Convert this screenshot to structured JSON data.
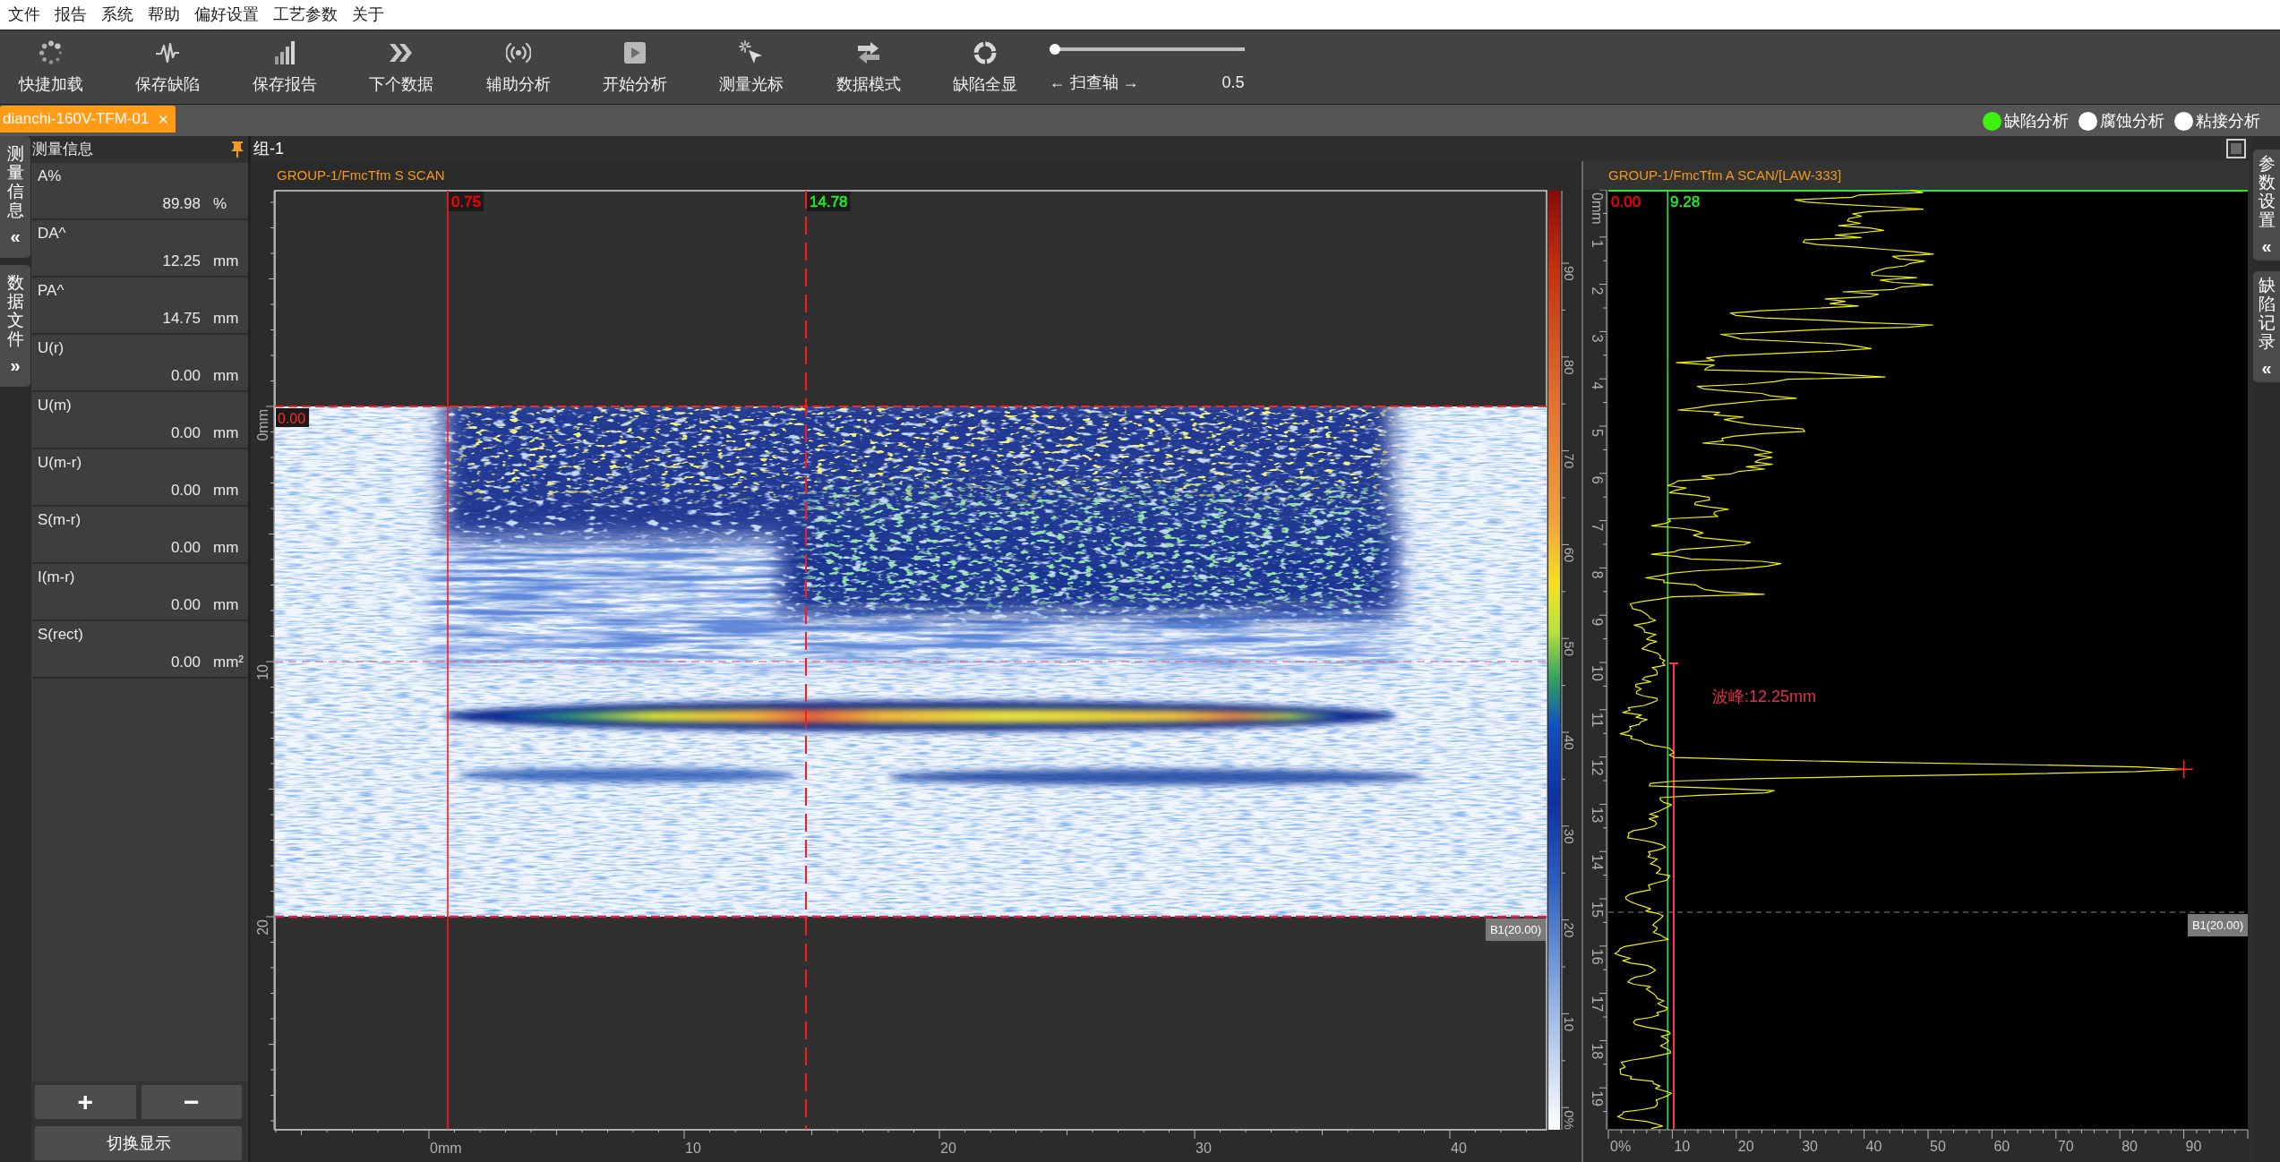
{
  "menu_bar": {
    "items": [
      "文件",
      "报告",
      "系统",
      "帮助",
      "偏好设置",
      "工艺参数",
      "关于"
    ]
  },
  "toolbar": {
    "buttons": [
      "快捷加载",
      "保存缺陷",
      "保存报告",
      "下个数据",
      "辅助分析",
      "开始分析",
      "测量光标",
      "数据模式",
      "缺陷全显"
    ],
    "slider": {
      "label": "← 扫查轴 →",
      "level": 0,
      "reading": "0.5"
    }
  },
  "file_tabs": [
    {
      "label": "dianchi-160V-TFM-01",
      "close": "×",
      "selected": true
    }
  ],
  "analysis_modes": [
    {
      "label": "缺陷分析",
      "selected": true
    },
    {
      "label": "腐蚀分析",
      "selected": false
    },
    {
      "label": "粘接分析",
      "selected": false
    }
  ],
  "left_dock_tabs": [
    {
      "label": "测量信息",
      "arrow": "«"
    },
    {
      "label": "数据文件",
      "arrow": "»"
    }
  ],
  "measurement_panel": {
    "title": "测量信息",
    "rows": [
      {
        "label": "A%",
        "value": "89.98",
        "unit": "%"
      },
      {
        "label": "DA^",
        "value": "12.25",
        "unit": "mm"
      },
      {
        "label": "PA^",
        "value": "14.75",
        "unit": "mm"
      },
      {
        "label": "U(r)",
        "value": "0.00",
        "unit": "mm"
      },
      {
        "label": "U(m)",
        "value": "0.00",
        "unit": "mm"
      },
      {
        "label": "U(m-r)",
        "value": "0.00",
        "unit": "mm"
      },
      {
        "label": "S(m-r)",
        "value": "0.00",
        "unit": "mm"
      },
      {
        "label": "I(m-r)",
        "value": "0.00",
        "unit": "mm"
      },
      {
        "label": "S(rect)",
        "value": "0.00",
        "unit": "mm²"
      }
    ],
    "buttons": [
      "+",
      "−"
    ],
    "switch_button": "切换显示"
  },
  "group": {
    "title": "组-1",
    "s_scan": {
      "title": "GROUP-1/FmcTfm S SCAN",
      "gate_label": "0.00",
      "cursor_labels": [
        {
          "text": "0.75",
          "color": "#ff0000"
        },
        {
          "text": "14.78",
          "color": "#22ee22"
        }
      ],
      "reference_badge": "B1(20.00)",
      "depth_ticks": [
        "0mm",
        "10",
        "20"
      ],
      "scan_ticks": [
        "0mm",
        "10",
        "20",
        "30",
        "40"
      ],
      "amplitude_ticks": [
        "90",
        "80",
        "70",
        "60",
        "50",
        "40",
        "30",
        "20",
        "10",
        "0%"
      ]
    },
    "a_scan": {
      "title": "GROUP-1/FmcTfm A SCAN/[LAW-333]",
      "cursor_labels": [
        {
          "text": "0.00",
          "color": "#ff0000"
        },
        {
          "text": "9.28",
          "color": "#22ee22"
        }
      ],
      "peak_label": "波峰:12.25mm",
      "reference_badge": "B1(20.00)",
      "depth_ticks": [
        "0mm",
        "1",
        "2",
        "3",
        "4",
        "5",
        "6",
        "7",
        "8",
        "9",
        "10",
        "11",
        "12",
        "13",
        "14",
        "15",
        "16",
        "17",
        "18",
        "19"
      ],
      "amplitude_ticks": [
        "0%",
        "10",
        "20",
        "30",
        "40",
        "50",
        "60",
        "70",
        "80",
        "90"
      ]
    }
  },
  "right_dock_tabs": [
    {
      "label": "参数设置",
      "arrow": "«"
    },
    {
      "label": "缺陷记录",
      "arrow": "«"
    }
  ]
}
